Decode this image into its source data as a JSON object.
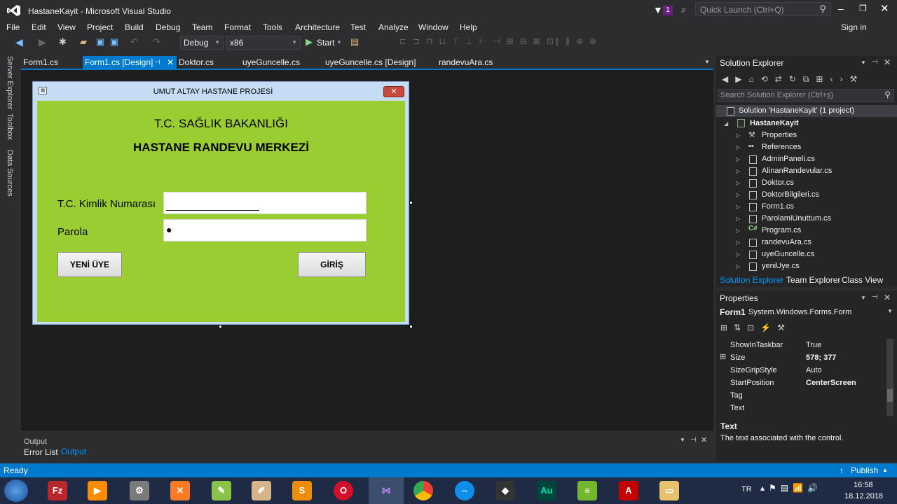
{
  "window": {
    "title": "HastaneKayit - Microsoft Visual Studio",
    "notification_count": "1",
    "quick_launch_placeholder": "Quick Launch (Ctrl+Q)",
    "sign_in": "Sign in"
  },
  "menu": [
    "File",
    "Edit",
    "View",
    "Project",
    "Build",
    "Debug",
    "Team",
    "Format",
    "Tools",
    "Architecture",
    "Test",
    "Analyze",
    "Window",
    "Help"
  ],
  "toolbar": {
    "config": "Debug",
    "platform": "x86",
    "start": "Start"
  },
  "left_tabs": [
    "Server Explorer",
    "Toolbox",
    "Data Sources"
  ],
  "doc_tabs": [
    {
      "label": "Form1.cs",
      "active": false
    },
    {
      "label": "Form1.cs [Design]",
      "active": true
    },
    {
      "label": "Doktor.cs",
      "active": false
    },
    {
      "label": "uyeGuncelle.cs",
      "active": false
    },
    {
      "label": "uyeGuncelle.cs [Design]",
      "active": false
    },
    {
      "label": "randevuAra.cs",
      "active": false
    }
  ],
  "form": {
    "title": "UMUT ALTAY HASTANE PROJESİ",
    "heading1": "T.C. SAĞLIK BAKANLIĞI",
    "heading2": "HASTANE RANDEVU MERKEZİ",
    "tc_label": "T.C. Kimlik Numarası",
    "password_label": "Parola",
    "password_mask": "●",
    "btn_register": "YENİ ÜYE",
    "btn_login": "GİRİŞ",
    "back_color": "#9acd32"
  },
  "output": {
    "title": "Output",
    "tabs": [
      "Error List",
      "Output"
    ]
  },
  "solution_explorer": {
    "title": "Solution Explorer",
    "search_placeholder": "Search Solution Explorer (Ctrl+ş)",
    "solution": "Solution 'HastaneKayit' (1 project)",
    "project": "HastaneKayit",
    "items": [
      "Properties",
      "References",
      "AdminPaneli.cs",
      "AlinanRandevular.cs",
      "Doktor.cs",
      "DoktorBilgileri.cs",
      "Form1.cs",
      "ParolamiUnuttum.cs",
      "Program.cs",
      "randevuAra.cs",
      "uyeGuncelle.cs",
      "yeniUye.cs"
    ],
    "bottom_tabs": [
      "Solution Explorer",
      "Team Explorer",
      "Class View"
    ]
  },
  "properties": {
    "title": "Properties",
    "object": "Form1",
    "object_type": "System.Windows.Forms.Form",
    "rows": [
      {
        "name": "ShowInTaskbar",
        "value": "True",
        "bold": false
      },
      {
        "name": "Size",
        "value": "578; 377",
        "bold": true
      },
      {
        "name": "SizeGripStyle",
        "value": "Auto",
        "bold": false
      },
      {
        "name": "StartPosition",
        "value": "CenterScreen",
        "bold": true
      },
      {
        "name": "Tag",
        "value": "",
        "bold": false
      },
      {
        "name": "Text",
        "value": "",
        "bold": false
      }
    ],
    "desc_title": "Text",
    "desc_text": "The text associated with the control."
  },
  "status": {
    "ready": "Ready",
    "publish": "Publish"
  },
  "taskbar": {
    "lang": "TR",
    "time": "16:58",
    "date": "18.12.2018",
    "apps": [
      "start-icon",
      "filezilla-icon",
      "media-player-icon",
      "file-manager-icon",
      "xampp-icon",
      "notepad-plus-icon",
      "paint-icon",
      "sublime-icon",
      "opera-icon",
      "visual-studio-icon",
      "chrome-icon",
      "teamviewer-icon",
      "inkscape-icon",
      "audition-icon",
      "bluestacks-icon",
      "acrobat-icon",
      "explorer-icon"
    ]
  },
  "colors": {
    "accent": "#007acc",
    "bg": "#2d2d30",
    "designer_bg": "#1e1e1e",
    "form_green": "#9acd32"
  }
}
